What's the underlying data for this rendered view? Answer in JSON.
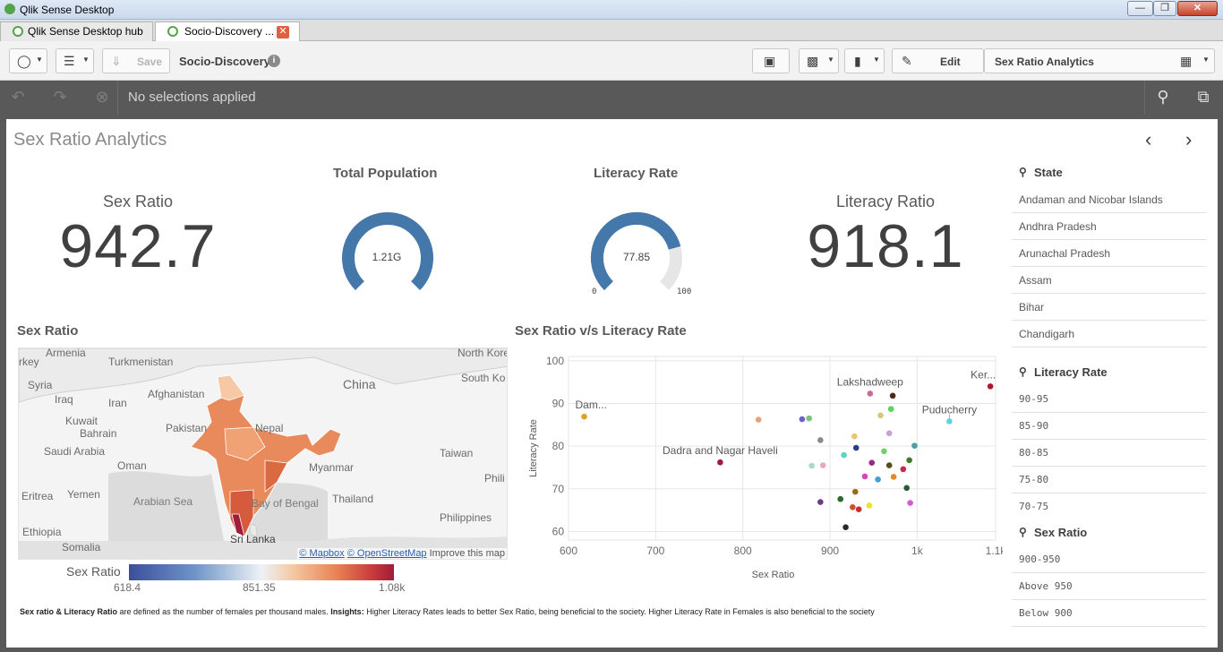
{
  "window": {
    "title": "Qlik Sense Desktop"
  },
  "tabs": [
    {
      "label": "Qlik Sense Desktop hub"
    },
    {
      "label": "Socio-Discovery ..."
    }
  ],
  "toolbar": {
    "save_label": "Save",
    "app_name": "Socio-Discovery",
    "edit_label": "Edit",
    "sheet_name": "Sex Ratio Analytics"
  },
  "selections": {
    "text": "No selections applied"
  },
  "sheet": {
    "title": "Sex Ratio Analytics"
  },
  "kpis": {
    "sex_ratio": {
      "label": "Sex Ratio",
      "value": "942.7"
    },
    "literacy_ratio": {
      "label": "Literacy Ratio",
      "value": "918.1"
    }
  },
  "gauges": {
    "total_population": {
      "title": "Total Population",
      "value_text": "1.21G",
      "fraction": 1.0
    },
    "literacy_rate": {
      "title": "Literacy Rate",
      "value_text": "77.85",
      "fraction": 0.7785,
      "min": "0",
      "max": "100"
    }
  },
  "map": {
    "title": "Sex Ratio",
    "labels": [
      "Armenia",
      "rkey",
      "Turkmenistan",
      "Syria",
      "Iraq",
      "Afghanistan",
      "Iran",
      "China",
      "South Ko",
      "North Kore",
      "Kuwait",
      "Bahrain",
      "Pakistan",
      "Nepal",
      "Saudi Arabia",
      "Oman",
      "Taiwan",
      "Myanmar",
      "Eritrea",
      "Yemen",
      "Arabian Sea",
      "Bay of Bengal",
      "Thailand",
      "Phili",
      "Philippines",
      "Ethiopia",
      "Somalia",
      "Sri Lanka"
    ],
    "credit_mapbox": "© Mapbox",
    "credit_osm": "© OpenStreetMap",
    "credit_improve": "Improve this map",
    "legend": {
      "title": "Sex Ratio",
      "min": "618.4",
      "mid": "851.35",
      "max": "1.08k"
    }
  },
  "footnote": {
    "bold1": "Sex ratio & Literacy Ratio",
    "text1": " are defined as the number of females per thousand males. ",
    "bold2": "Insights:",
    "text2": " Higher Literacy Rates leads to better Sex Ratio, being beneficial to the society. Higher Literacy Rate in Females is also beneficial to the society"
  },
  "chart_data": {
    "type": "scatter",
    "title": "Sex Ratio v/s Literacy Rate",
    "xlabel": "Sex Ratio",
    "ylabel": "Literacy Rate",
    "xlim": [
      600,
      1090
    ],
    "ylim": [
      58,
      101
    ],
    "xticks": [
      "600",
      "700",
      "800",
      "900",
      "1k",
      "1.1k"
    ],
    "yticks": [
      "60",
      "70",
      "80",
      "90",
      "100"
    ],
    "grid": true,
    "points": [
      {
        "x": 618,
        "y": 86.9,
        "color": "#e0a02a",
        "label": "Dam..."
      },
      {
        "x": 774,
        "y": 76.2,
        "color": "#a0174f",
        "label": "Dadra and Nagar Haveli"
      },
      {
        "x": 946,
        "y": 92.3,
        "color": "#c96a9a",
        "label": "Lakshadweep"
      },
      {
        "x": 1037,
        "y": 85.8,
        "color": "#5fd3e6",
        "label": "Puducherry"
      },
      {
        "x": 1084,
        "y": 94.0,
        "color": "#b0172b",
        "label": "Ker..."
      },
      {
        "x": 818,
        "y": 86.2,
        "color": "#e8a27a",
        "label": ""
      },
      {
        "x": 868,
        "y": 86.3,
        "color": "#6b63c9",
        "label": ""
      },
      {
        "x": 876,
        "y": 86.5,
        "color": "#7dc27d",
        "label": ""
      },
      {
        "x": 879,
        "y": 75.4,
        "color": "#a8d8d0",
        "label": ""
      },
      {
        "x": 889,
        "y": 81.4,
        "color": "#8a8a8a",
        "label": ""
      },
      {
        "x": 892,
        "y": 75.5,
        "color": "#e8a7c3",
        "label": ""
      },
      {
        "x": 889,
        "y": 66.9,
        "color": "#6b3f7f",
        "label": ""
      },
      {
        "x": 916,
        "y": 77.9,
        "color": "#5fd3c6",
        "label": ""
      },
      {
        "x": 918,
        "y": 61.0,
        "color": "#2a2a2a",
        "label": ""
      },
      {
        "x": 912,
        "y": 67.6,
        "color": "#2a6b2a",
        "label": ""
      },
      {
        "x": 926,
        "y": 65.7,
        "color": "#d44a2a",
        "label": ""
      },
      {
        "x": 928,
        "y": 82.3,
        "color": "#e8c76a",
        "label": ""
      },
      {
        "x": 929,
        "y": 69.3,
        "color": "#9a6b1a",
        "label": ""
      },
      {
        "x": 930,
        "y": 79.6,
        "color": "#2a3f7f",
        "label": ""
      },
      {
        "x": 933,
        "y": 65.2,
        "color": "#c9302a",
        "label": ""
      },
      {
        "x": 940,
        "y": 72.9,
        "color": "#d44ab3",
        "label": ""
      },
      {
        "x": 945,
        "y": 66.1,
        "color": "#f0e02a",
        "label": ""
      },
      {
        "x": 948,
        "y": 76.1,
        "color": "#9a2a8a",
        "label": ""
      },
      {
        "x": 955,
        "y": 72.2,
        "color": "#4a9ad4",
        "label": ""
      },
      {
        "x": 958,
        "y": 87.2,
        "color": "#d4c87a",
        "label": ""
      },
      {
        "x": 962,
        "y": 78.8,
        "color": "#6ad46a",
        "label": ""
      },
      {
        "x": 968,
        "y": 75.5,
        "color": "#5a4a1a",
        "label": ""
      },
      {
        "x": 968,
        "y": 83.0,
        "color": "#c9a0d4",
        "label": ""
      },
      {
        "x": 970,
        "y": 88.7,
        "color": "#5ad45a",
        "label": ""
      },
      {
        "x": 972,
        "y": 91.8,
        "color": "#4a2a1a",
        "label": ""
      },
      {
        "x": 973,
        "y": 72.8,
        "color": "#e08a2a",
        "label": ""
      },
      {
        "x": 984,
        "y": 74.6,
        "color": "#c92a4a",
        "label": ""
      },
      {
        "x": 988,
        "y": 70.2,
        "color": "#2a5a3a",
        "label": ""
      },
      {
        "x": 991,
        "y": 76.7,
        "color": "#3a7a2a",
        "label": ""
      },
      {
        "x": 992,
        "y": 66.7,
        "color": "#d45ad4",
        "label": ""
      },
      {
        "x": 997,
        "y": 80.1,
        "color": "#4aa0a0",
        "label": ""
      }
    ]
  }
}
